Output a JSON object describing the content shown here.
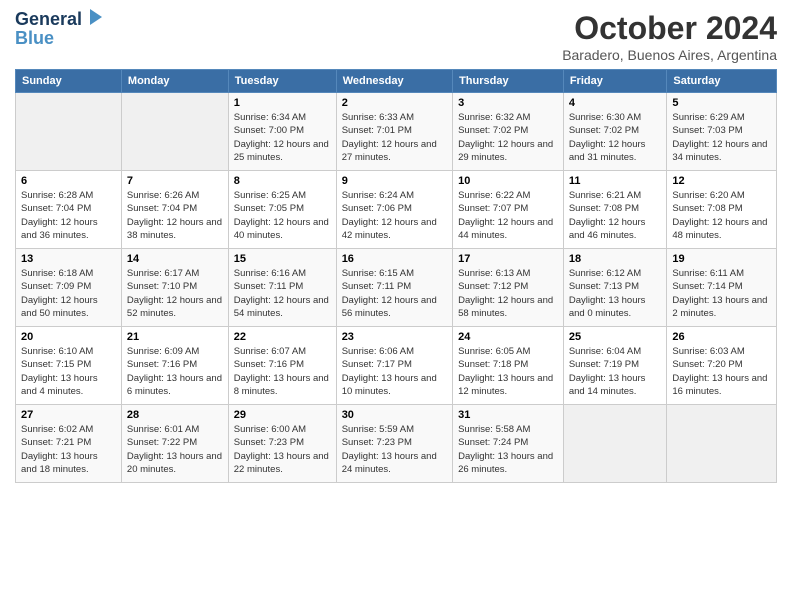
{
  "logo": {
    "line1": "General",
    "line2": "Blue"
  },
  "title": "October 2024",
  "subtitle": "Baradero, Buenos Aires, Argentina",
  "days_of_week": [
    "Sunday",
    "Monday",
    "Tuesday",
    "Wednesday",
    "Thursday",
    "Friday",
    "Saturday"
  ],
  "weeks": [
    [
      {
        "day": "",
        "sunrise": "",
        "sunset": "",
        "daylight": ""
      },
      {
        "day": "",
        "sunrise": "",
        "sunset": "",
        "daylight": ""
      },
      {
        "day": "1",
        "sunrise": "Sunrise: 6:34 AM",
        "sunset": "Sunset: 7:00 PM",
        "daylight": "Daylight: 12 hours and 25 minutes."
      },
      {
        "day": "2",
        "sunrise": "Sunrise: 6:33 AM",
        "sunset": "Sunset: 7:01 PM",
        "daylight": "Daylight: 12 hours and 27 minutes."
      },
      {
        "day": "3",
        "sunrise": "Sunrise: 6:32 AM",
        "sunset": "Sunset: 7:02 PM",
        "daylight": "Daylight: 12 hours and 29 minutes."
      },
      {
        "day": "4",
        "sunrise": "Sunrise: 6:30 AM",
        "sunset": "Sunset: 7:02 PM",
        "daylight": "Daylight: 12 hours and 31 minutes."
      },
      {
        "day": "5",
        "sunrise": "Sunrise: 6:29 AM",
        "sunset": "Sunset: 7:03 PM",
        "daylight": "Daylight: 12 hours and 34 minutes."
      }
    ],
    [
      {
        "day": "6",
        "sunrise": "Sunrise: 6:28 AM",
        "sunset": "Sunset: 7:04 PM",
        "daylight": "Daylight: 12 hours and 36 minutes."
      },
      {
        "day": "7",
        "sunrise": "Sunrise: 6:26 AM",
        "sunset": "Sunset: 7:04 PM",
        "daylight": "Daylight: 12 hours and 38 minutes."
      },
      {
        "day": "8",
        "sunrise": "Sunrise: 6:25 AM",
        "sunset": "Sunset: 7:05 PM",
        "daylight": "Daylight: 12 hours and 40 minutes."
      },
      {
        "day": "9",
        "sunrise": "Sunrise: 6:24 AM",
        "sunset": "Sunset: 7:06 PM",
        "daylight": "Daylight: 12 hours and 42 minutes."
      },
      {
        "day": "10",
        "sunrise": "Sunrise: 6:22 AM",
        "sunset": "Sunset: 7:07 PM",
        "daylight": "Daylight: 12 hours and 44 minutes."
      },
      {
        "day": "11",
        "sunrise": "Sunrise: 6:21 AM",
        "sunset": "Sunset: 7:08 PM",
        "daylight": "Daylight: 12 hours and 46 minutes."
      },
      {
        "day": "12",
        "sunrise": "Sunrise: 6:20 AM",
        "sunset": "Sunset: 7:08 PM",
        "daylight": "Daylight: 12 hours and 48 minutes."
      }
    ],
    [
      {
        "day": "13",
        "sunrise": "Sunrise: 6:18 AM",
        "sunset": "Sunset: 7:09 PM",
        "daylight": "Daylight: 12 hours and 50 minutes."
      },
      {
        "day": "14",
        "sunrise": "Sunrise: 6:17 AM",
        "sunset": "Sunset: 7:10 PM",
        "daylight": "Daylight: 12 hours and 52 minutes."
      },
      {
        "day": "15",
        "sunrise": "Sunrise: 6:16 AM",
        "sunset": "Sunset: 7:11 PM",
        "daylight": "Daylight: 12 hours and 54 minutes."
      },
      {
        "day": "16",
        "sunrise": "Sunrise: 6:15 AM",
        "sunset": "Sunset: 7:11 PM",
        "daylight": "Daylight: 12 hours and 56 minutes."
      },
      {
        "day": "17",
        "sunrise": "Sunrise: 6:13 AM",
        "sunset": "Sunset: 7:12 PM",
        "daylight": "Daylight: 12 hours and 58 minutes."
      },
      {
        "day": "18",
        "sunrise": "Sunrise: 6:12 AM",
        "sunset": "Sunset: 7:13 PM",
        "daylight": "Daylight: 13 hours and 0 minutes."
      },
      {
        "day": "19",
        "sunrise": "Sunrise: 6:11 AM",
        "sunset": "Sunset: 7:14 PM",
        "daylight": "Daylight: 13 hours and 2 minutes."
      }
    ],
    [
      {
        "day": "20",
        "sunrise": "Sunrise: 6:10 AM",
        "sunset": "Sunset: 7:15 PM",
        "daylight": "Daylight: 13 hours and 4 minutes."
      },
      {
        "day": "21",
        "sunrise": "Sunrise: 6:09 AM",
        "sunset": "Sunset: 7:16 PM",
        "daylight": "Daylight: 13 hours and 6 minutes."
      },
      {
        "day": "22",
        "sunrise": "Sunrise: 6:07 AM",
        "sunset": "Sunset: 7:16 PM",
        "daylight": "Daylight: 13 hours and 8 minutes."
      },
      {
        "day": "23",
        "sunrise": "Sunrise: 6:06 AM",
        "sunset": "Sunset: 7:17 PM",
        "daylight": "Daylight: 13 hours and 10 minutes."
      },
      {
        "day": "24",
        "sunrise": "Sunrise: 6:05 AM",
        "sunset": "Sunset: 7:18 PM",
        "daylight": "Daylight: 13 hours and 12 minutes."
      },
      {
        "day": "25",
        "sunrise": "Sunrise: 6:04 AM",
        "sunset": "Sunset: 7:19 PM",
        "daylight": "Daylight: 13 hours and 14 minutes."
      },
      {
        "day": "26",
        "sunrise": "Sunrise: 6:03 AM",
        "sunset": "Sunset: 7:20 PM",
        "daylight": "Daylight: 13 hours and 16 minutes."
      }
    ],
    [
      {
        "day": "27",
        "sunrise": "Sunrise: 6:02 AM",
        "sunset": "Sunset: 7:21 PM",
        "daylight": "Daylight: 13 hours and 18 minutes."
      },
      {
        "day": "28",
        "sunrise": "Sunrise: 6:01 AM",
        "sunset": "Sunset: 7:22 PM",
        "daylight": "Daylight: 13 hours and 20 minutes."
      },
      {
        "day": "29",
        "sunrise": "Sunrise: 6:00 AM",
        "sunset": "Sunset: 7:23 PM",
        "daylight": "Daylight: 13 hours and 22 minutes."
      },
      {
        "day": "30",
        "sunrise": "Sunrise: 5:59 AM",
        "sunset": "Sunset: 7:23 PM",
        "daylight": "Daylight: 13 hours and 24 minutes."
      },
      {
        "day": "31",
        "sunrise": "Sunrise: 5:58 AM",
        "sunset": "Sunset: 7:24 PM",
        "daylight": "Daylight: 13 hours and 26 minutes."
      },
      {
        "day": "",
        "sunrise": "",
        "sunset": "",
        "daylight": ""
      },
      {
        "day": "",
        "sunrise": "",
        "sunset": "",
        "daylight": ""
      }
    ]
  ]
}
